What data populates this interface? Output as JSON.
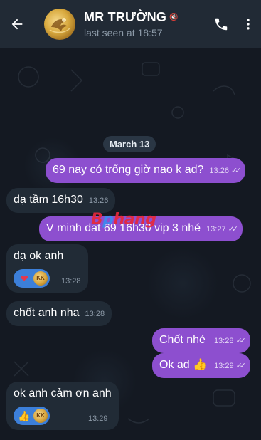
{
  "header": {
    "contact_name": "MR TRƯỜNG",
    "status": "last seen at 18:57",
    "icons": [
      "back-arrow-icon",
      "avatar",
      "mute-icon",
      "phone-icon",
      "more-vertical-icon"
    ]
  },
  "chat": {
    "date_separator": "March 13",
    "watermark": "Bphang",
    "messages": [
      {
        "direction": "out",
        "text": "69 nay có trống giờ nao k ad?",
        "time": "13:26",
        "ticks": "✓✓"
      },
      {
        "direction": "in",
        "text": "dạ tầm 16h30",
        "time": "13:26"
      },
      {
        "direction": "out",
        "text": "V minh dat 69 16h30 vip 3 nhé",
        "time": "13:27",
        "ticks": "✓✓"
      },
      {
        "direction": "in",
        "text": "dạ ok anh",
        "time": "13:28",
        "reaction": {
          "emoji": "❤",
          "user": "KK"
        }
      },
      {
        "direction": "in",
        "text": "chốt anh nha",
        "time": "13:28"
      },
      {
        "direction": "out",
        "text": "Chốt nhé",
        "time": "13:28",
        "ticks": "✓✓"
      },
      {
        "direction": "out",
        "text": "Ok ad 👍",
        "time": "13:29",
        "ticks": "✓✓"
      },
      {
        "direction": "in",
        "text": "ok anh cảm ơn anh",
        "time": "13:29",
        "reaction": {
          "emoji": "👍",
          "user": "KK"
        }
      }
    ]
  },
  "colors": {
    "header_bg": "#212a35",
    "chat_bg": "#141922",
    "outgoing_bubble": "#8d4fcf",
    "incoming_bubble": "#212b36",
    "reaction_bg": "#3c7fd9"
  }
}
